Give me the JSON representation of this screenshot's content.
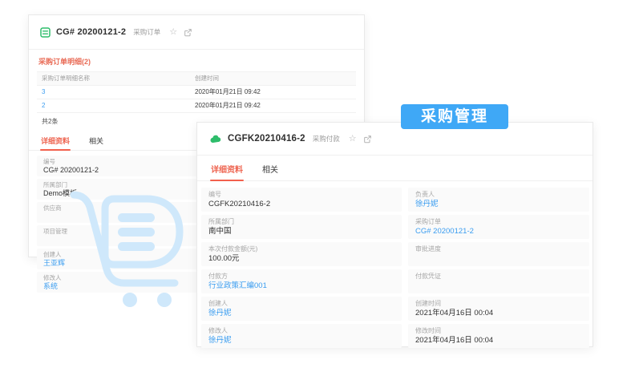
{
  "colors": {
    "accent_link_blue": "#3b9df0",
    "badge_blue": "#3fa8f6",
    "active_tab_red": "#ee6450",
    "icon_green": "#2ebd6b",
    "watermark_blue": "#cfe8fb"
  },
  "icons": {
    "star": "☆"
  },
  "badge": {
    "label": "采购管理"
  },
  "order_panel": {
    "title": "CG# 20200121-2",
    "object_type_label": "采购订单",
    "related_list": {
      "title": "采购订单明细(2)",
      "col_name": "采购订单明细名称",
      "col_created": "创建时间",
      "rows": [
        {
          "name": "3",
          "created_time": "2020年01月21日 09:42"
        },
        {
          "name": "2",
          "created_time": "2020年01月21日 09:42"
        }
      ],
      "summary": "共2条"
    },
    "tabs": {
      "detail": "详细资料",
      "related": "相关"
    },
    "fields": [
      {
        "label": "编号",
        "value": "CG# 20200121-2"
      },
      {
        "label": "所属部门",
        "value": "Demo模板"
      },
      {
        "label": "供应商",
        "value": ""
      },
      {
        "label": "项目管理",
        "value": ""
      },
      {
        "label": "创建人",
        "value": "王亚辉"
      },
      {
        "label": "修改人",
        "value": "系统"
      }
    ]
  },
  "payment_panel": {
    "title": "CGFK20210416-2",
    "object_type_label": "采购付款",
    "tabs": {
      "detail": "详细资料",
      "related": "相关"
    },
    "left_fields": [
      {
        "label": "编号",
        "value": "CGFK20210416-2"
      },
      {
        "label": "所属部门",
        "value": "南中国"
      },
      {
        "label": "本次付款金额(元)",
        "value": "100.00元"
      },
      {
        "label": "付款方",
        "value": "行业政策汇编001"
      },
      {
        "label": "创建人",
        "value": "徐丹妮"
      },
      {
        "label": "修改人",
        "value": "徐丹妮"
      }
    ],
    "right_fields": [
      {
        "label": "负责人",
        "value": "徐丹妮"
      },
      {
        "label": "采购订单",
        "value": "CG# 20200121-2"
      },
      {
        "label": "审批进度",
        "value": ""
      },
      {
        "label": "付款凭证",
        "value": ""
      },
      {
        "label": "创建时间",
        "value": "2021年04月16日 00:04"
      },
      {
        "label": "修改时间",
        "value": "2021年04月16日 00:04"
      }
    ]
  }
}
